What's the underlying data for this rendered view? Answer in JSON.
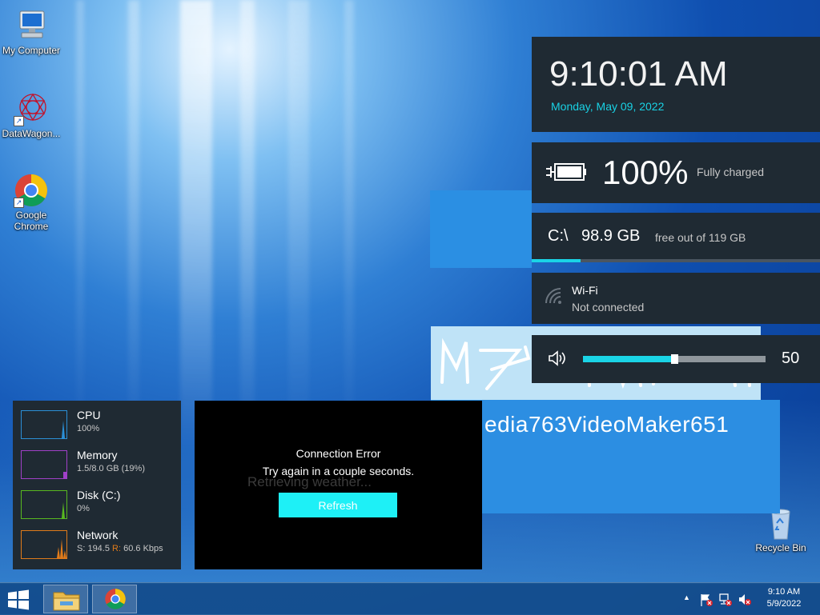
{
  "desktop": {
    "icons": [
      {
        "label": "My Computer"
      },
      {
        "label": "DataWagon..."
      },
      {
        "label": "Google Chrome"
      },
      {
        "label": "Recycle Bin"
      }
    ]
  },
  "widgets": {
    "clock": {
      "time": "9:10:01 AM",
      "date": "Monday, May 09, 2022"
    },
    "battery": {
      "percent": "100%",
      "status": "Fully charged"
    },
    "disk": {
      "drive": "C:\\",
      "size": "98.9 GB",
      "free": "free out of 119 GB",
      "used_fraction": 0.17
    },
    "wifi": {
      "name": "Wi-Fi",
      "status": "Not connected"
    },
    "volume": {
      "value": "50",
      "level": 0.5
    }
  },
  "video_maker": {
    "text": "edia763VideoMaker651"
  },
  "monitor": {
    "items": [
      {
        "label": "CPU",
        "value": "100%",
        "color": "#2b8fd6"
      },
      {
        "label": "Memory",
        "value": "1.5/8.0 GB (19%)",
        "color": "#a040c8"
      },
      {
        "label": "Disk (C:)",
        "value": "0%",
        "color": "#58b820"
      },
      {
        "label": "Network",
        "value": "S: 194.5 ",
        "value_r_label": "R:",
        "value_r": " 60.6 Kbps",
        "color": "#e07b1a"
      }
    ]
  },
  "weather": {
    "ghost_text": "Retrieving weather...",
    "error_title": "Connection Error",
    "error_message": "Try again in a couple seconds.",
    "refresh_label": "Refresh"
  },
  "taskbar": {
    "clock_time": "9:10 AM",
    "clock_date": "5/9/2022"
  },
  "colors": {
    "accent": "#1ad4e6",
    "widget_bg": "#1f2a33"
  }
}
